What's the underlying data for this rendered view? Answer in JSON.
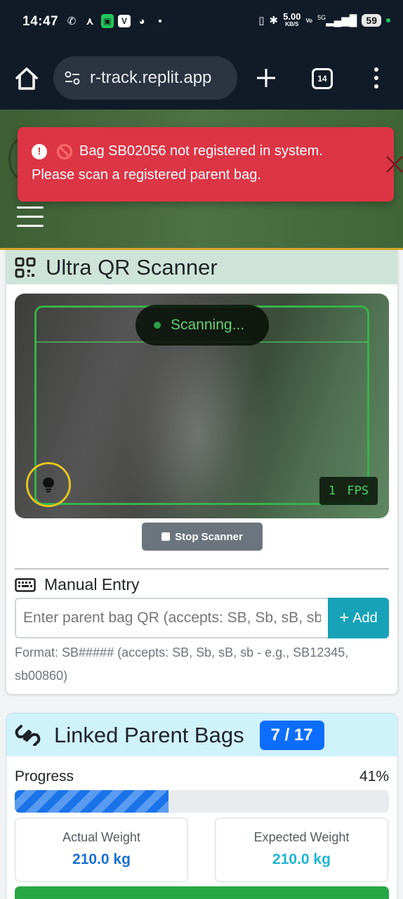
{
  "status_bar": {
    "time": "14:47",
    "net_speed": "5.00",
    "net_unit": "KB/S",
    "battery": "59",
    "volte": "Vo",
    "network": "5G"
  },
  "browser": {
    "url": "r-track.replit.app",
    "tab_count": "14"
  },
  "alert": {
    "line1": "Bag SB02056 not registered in system.",
    "line2": "Please scan a registered parent bag.",
    "color": "#dc3545"
  },
  "scanner": {
    "title": "Ultra QR Scanner",
    "status": "Scanning...",
    "fps_value": "1",
    "fps_label": "FPS",
    "stop_label": "Stop Scanner"
  },
  "manual_entry": {
    "title": "Manual Entry",
    "placeholder": "Enter parent bag QR (accepts: SB, Sb, sB, sb",
    "add_label": "Add",
    "format_help": "Format: SB##### (accepts: SB, Sb, sB, sb - e.g., SB12345, sb00860)"
  },
  "linked": {
    "title": "Linked Parent Bags",
    "count": "7 / 17",
    "progress_label": "Progress",
    "progress_pct": "41%",
    "progress_value": 0.41,
    "actual_weight_label": "Actual Weight",
    "actual_weight": "210.0 kg",
    "expected_weight_label": "Expected Weight",
    "expected_weight": "210.0 kg"
  },
  "colors": {
    "header_green": "#4d7244",
    "accent_blue": "#0d6efd",
    "info_cyan": "#17a2b8",
    "scan_green": "#36b34a"
  }
}
